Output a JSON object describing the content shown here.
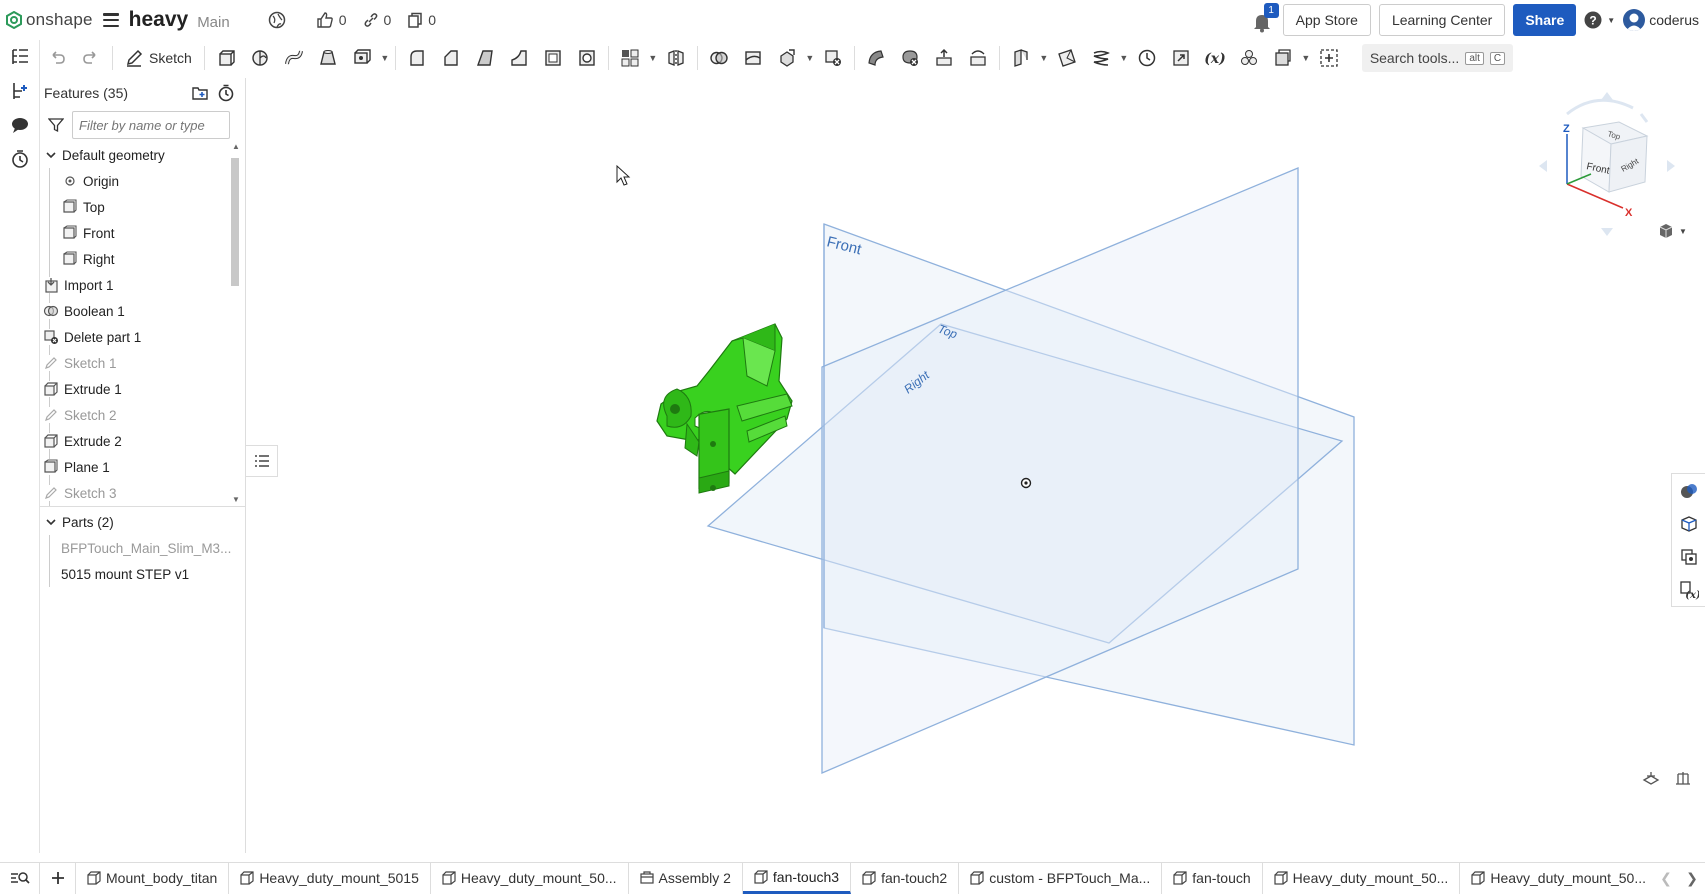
{
  "app": {
    "logo_text": "onshape",
    "document_name": "heavy",
    "branch": "Main",
    "likes": "0",
    "links": "0",
    "copies": "0",
    "notifications": "1",
    "app_store": "App Store",
    "learning_center": "Learning Center",
    "share": "Share",
    "username": "coderus"
  },
  "toolbar": {
    "sketch_label": "Sketch",
    "search_label": "Search tools...",
    "search_kbd1": "alt",
    "search_kbd2": "C"
  },
  "features": {
    "title": "Features (35)",
    "filter_placeholder": "Filter by name or type",
    "default_geometry": "Default geometry",
    "items": [
      {
        "label": "Origin",
        "icon": "origin-icon",
        "dim": false
      },
      {
        "label": "Top",
        "icon": "plane-icon",
        "dim": false
      },
      {
        "label": "Front",
        "icon": "plane-icon",
        "dim": false
      },
      {
        "label": "Right",
        "icon": "plane-icon",
        "dim": false
      },
      {
        "label": "Import 1",
        "icon": "import-icon",
        "dim": false
      },
      {
        "label": "Boolean 1",
        "icon": "boolean-icon",
        "dim": false
      },
      {
        "label": "Delete part 1",
        "icon": "delete-part-icon",
        "dim": false
      },
      {
        "label": "Sketch 1",
        "icon": "sketch-icon",
        "dim": true
      },
      {
        "label": "Extrude 1",
        "icon": "extrude-icon",
        "dim": false
      },
      {
        "label": "Sketch 2",
        "icon": "sketch-icon",
        "dim": true
      },
      {
        "label": "Extrude 2",
        "icon": "extrude-icon",
        "dim": false
      },
      {
        "label": "Plane 1",
        "icon": "plane-icon",
        "dim": false
      },
      {
        "label": "Sketch 3",
        "icon": "sketch-icon",
        "dim": true
      }
    ],
    "parts_title": "Parts (2)",
    "parts": [
      {
        "label": "BFPTouch_Main_Slim_M3...",
        "dim": true
      },
      {
        "label": "5015 mount STEP v1",
        "dim": false
      }
    ]
  },
  "viewport": {
    "plane_front": "Front",
    "plane_top": "Top",
    "plane_right": "Right",
    "cube_front": "Front",
    "cube_top": "Top",
    "cube_right": "Right",
    "axis_z": "Z",
    "axis_x": "X",
    "part_color": "#39d11f",
    "plane_color": "#8fb1dc"
  },
  "tabs": [
    {
      "label": "Mount_body_titan",
      "icon": "part-studio-icon",
      "active": false
    },
    {
      "label": "Heavy_duty_mount_5015",
      "icon": "part-studio-icon",
      "active": false
    },
    {
      "label": "Heavy_duty_mount_50...",
      "icon": "part-studio-icon",
      "active": false
    },
    {
      "label": "Assembly 2",
      "icon": "assembly-icon",
      "active": false
    },
    {
      "label": "fan-touch3",
      "icon": "part-studio-icon",
      "active": true
    },
    {
      "label": "fan-touch2",
      "icon": "part-studio-icon",
      "active": false
    },
    {
      "label": "custom - BFPTouch_Ma...",
      "icon": "part-studio-icon",
      "active": false
    },
    {
      "label": "fan-touch",
      "icon": "part-studio-icon",
      "active": false
    },
    {
      "label": "Heavy_duty_mount_50...",
      "icon": "part-studio-icon",
      "active": false
    },
    {
      "label": "Heavy_duty_mount_50...",
      "icon": "part-studio-icon",
      "active": false
    }
  ],
  "colors": {
    "accent": "#1e5bbf",
    "logo": "#2c9a5a"
  }
}
